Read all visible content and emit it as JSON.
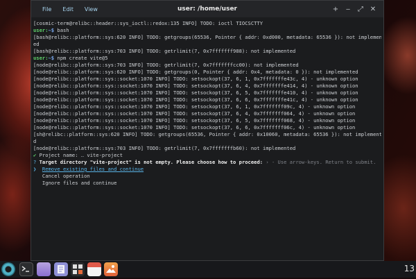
{
  "window": {
    "title": "user: /home/user",
    "menu": [
      "File",
      "Edit",
      "View"
    ],
    "controls": [
      "+",
      "‒",
      "⤢",
      "✕"
    ]
  },
  "terminal": {
    "lines": [
      "[cosmic-term@relibc::header::sys_ioctl::redox:135 INFO] TODO: ioctl TIOCSCTTY",
      "$PROMPT bash",
      "[bash@relibc::platform::sys:620 INFO] TODO: getgroups(65536, Pointer { addr: 0xd000, metadata: 65536 }): not implemen",
      "ed",
      "[bash@relibc::platform::sys:703 INFO] TODO: getrlimit(7, 0x7fffffff988): not implemented",
      "$PROMPT npm create vite@5",
      "[node@relibc::platform::sys:703 INFO] TODO: getrlimit(7, 0x7fffffffcc00): not implemented",
      "[node@relibc::platform::sys:620 INFO] TODO: getgroups(0, Pointer { addr: 0x4, metadata: 0 }): not implemented",
      "[node@relibc::platform::sys::socket:1070 INFO] TODO: setsockopt(37, 6, 1, 0x7fffffffe43c, 4) - unknown option",
      "[node@relibc::platform::sys::socket:1070 INFO] TODO: setsockopt(37, 6, 4, 0x7fffffffe414, 4) - unknown option",
      "[node@relibc::platform::sys::socket:1070 INFO] TODO: setsockopt(37, 6, 5, 0x7fffffffe410, 4) - unknown option",
      "[node@relibc::platform::sys::socket:1070 INFO] TODO: setsockopt(37, 6, 6, 0x7fffffffe41c, 4) - unknown option",
      "[node@relibc::platform::sys::socket:1070 INFO] TODO: setsockopt(37, 6, 1, 0x7fffffff09c, 4) - unknown option",
      "[node@relibc::platform::sys::socket:1070 INFO] TODO: setsockopt(37, 6, 4, 0x7fffffff064, 4) - unknown option",
      "[node@relibc::platform::sys::socket:1070 INFO] TODO: setsockopt(37, 6, 5, 0x7fffffff068, 4) - unknown option",
      "[node@relibc::platform::sys::socket:1070 INFO] TODO: setsockopt(37, 6, 6, 0x7fffffff06c, 4) - unknown option",
      "[sh@relibc::platform::sys:620 INFO] TODO: getgroups(65536, Pointer { addr: 0x10060, metadata: 65536 }): not implemente",
      "d",
      "[node@relibc::platform::sys:703 INFO] TODO: getrlimit(7, 0x7fffffffb60): not implemented"
    ],
    "prompt_user": "user:",
    "prompt_path": "~$",
    "project_name_label": "Project name:",
    "project_name_sep": "…",
    "project_name_value": "vite-project",
    "question_mark": "?",
    "question_text": "Target directory \"vite-project\" is not empty. Please choose how to proceed:",
    "question_hint": "› - Use arrow-keys. Return to submit.",
    "options": [
      "Remove existing files and continue",
      "Cancel operation",
      "Ignore files and continue"
    ],
    "selected_option": "Remove existing files and continue"
  },
  "dock": {
    "clock": "13",
    "items": [
      "cosmic-icon",
      "terminal-icon",
      "files-icon",
      "text-editor-icon",
      "calculator-icon",
      "calendar-icon",
      "image-viewer-icon"
    ]
  }
}
